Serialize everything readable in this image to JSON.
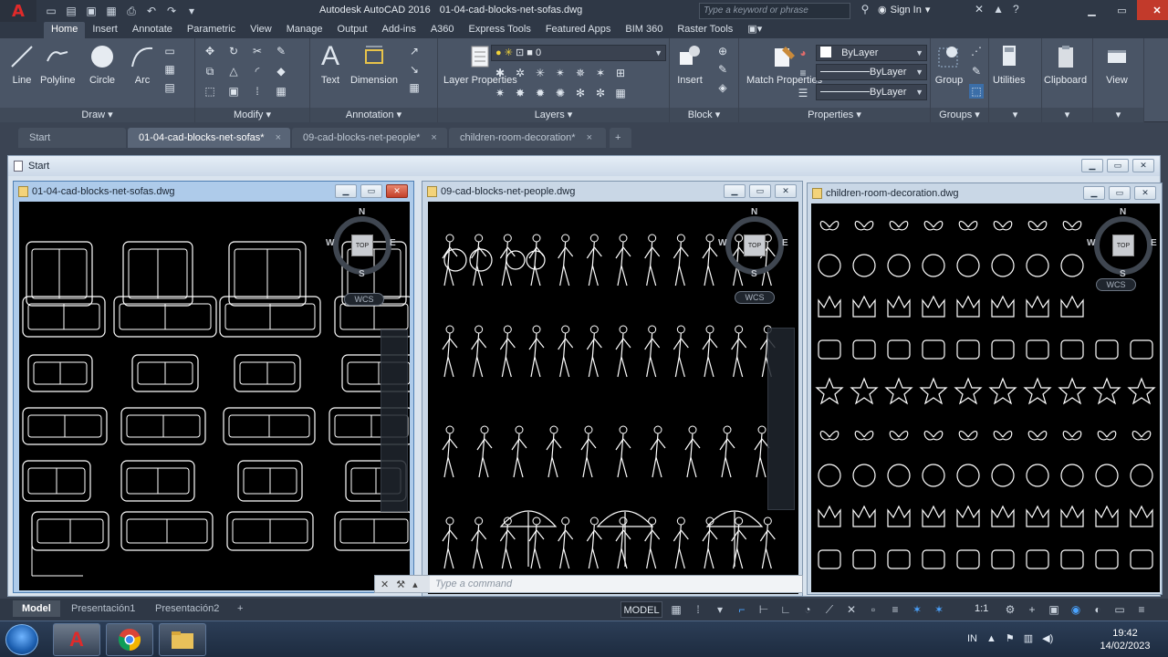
{
  "title": {
    "app": "Autodesk AutoCAD 2016",
    "file": "01-04-cad-blocks-net-sofas.dwg",
    "search_placeholder": "Type a keyword or phrase",
    "signin": "Sign In"
  },
  "ribbon_tabs": [
    "Home",
    "Insert",
    "Annotate",
    "Parametric",
    "View",
    "Manage",
    "Output",
    "Add-ins",
    "A360",
    "Express Tools",
    "Featured Apps",
    "BIM 360",
    "Raster Tools"
  ],
  "ribbon": {
    "draw": {
      "title": "Draw",
      "line": "Line",
      "polyline": "Polyline",
      "circle": "Circle",
      "arc": "Arc"
    },
    "modify": {
      "title": "Modify"
    },
    "annotation": {
      "title": "Annotation",
      "text": "Text",
      "dimension": "Dimension"
    },
    "layers": {
      "title": "Layers",
      "layer_properties": "Layer Properties",
      "layer_value": "0"
    },
    "block": {
      "title": "Block",
      "insert": "Insert"
    },
    "properties": {
      "title": "Properties",
      "match_properties": "Match Properties",
      "color": "ByLayer",
      "linetype": "ByLayer",
      "lineweight": "ByLayer"
    },
    "groups": {
      "title": "Groups",
      "group": "Group"
    },
    "utilities": "Utilities",
    "clipboard": "Clipboard",
    "view": "View"
  },
  "file_tabs": [
    {
      "label": "Start",
      "close": ""
    },
    {
      "label": "01-04-cad-blocks-net-sofas*",
      "close": "×"
    },
    {
      "label": "09-cad-blocks-net-people*",
      "close": "×"
    },
    {
      "label": "children-room-decoration*",
      "close": "×"
    }
  ],
  "mdi": {
    "start_title": "Start",
    "windows": [
      {
        "title": "01-04-cad-blocks-net-sofas.dwg"
      },
      {
        "title": "09-cad-blocks-net-people.dwg"
      },
      {
        "title": "children-room-decoration.dwg"
      }
    ],
    "viewcube": {
      "n": "N",
      "s": "S",
      "e": "E",
      "w": "W",
      "top": "TOP",
      "wcs": "WCS"
    }
  },
  "command_line": {
    "placeholder": "Type a command"
  },
  "layout_tabs": [
    "Model",
    "Presentación1",
    "Presentación2"
  ],
  "status": {
    "model": "MODEL",
    "scale": "1:1"
  },
  "tray": {
    "lang": "IN"
  },
  "clock": {
    "time": "19:42",
    "date": "14/02/2023"
  },
  "colors": {
    "accent": "#4aa3ff",
    "close": "#c23a2b",
    "canvas": "#000000",
    "ui_dark": "#2f3846",
    "ui_mid": "#4a5566"
  }
}
